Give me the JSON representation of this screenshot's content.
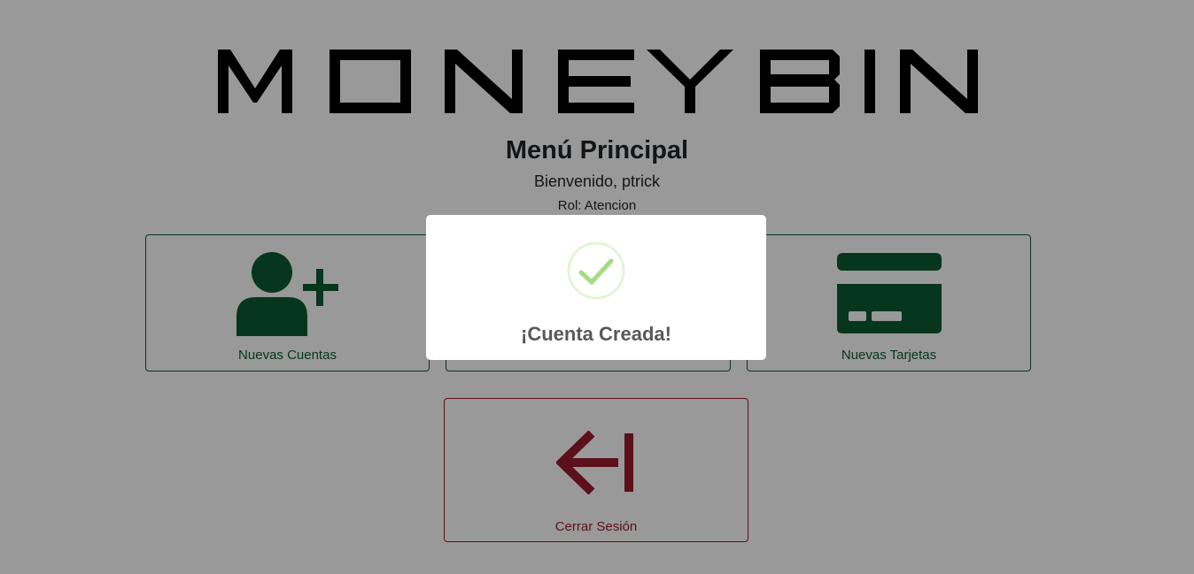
{
  "logo_text": "MONEY BIN",
  "header": {
    "title": "Menú Principal",
    "welcome": "Bienvenido, ptrick",
    "role": "Rol: Atencion"
  },
  "cards": [
    {
      "label": "Nuevas Cuentas",
      "icon": "user-plus-icon"
    },
    {
      "label": "",
      "icon": ""
    },
    {
      "label": "Nuevas Tarjetas",
      "icon": "credit-card-icon"
    }
  ],
  "logout": {
    "label": "Cerrar Sesión",
    "icon": "logout-arrow-icon"
  },
  "modal": {
    "title": "¡Cuenta Creada!",
    "icon": "success-check-icon"
  },
  "colors": {
    "primary_green": "#0d5a33",
    "danger_red": "#9b1c2e",
    "success_light": "#a5dc86"
  }
}
